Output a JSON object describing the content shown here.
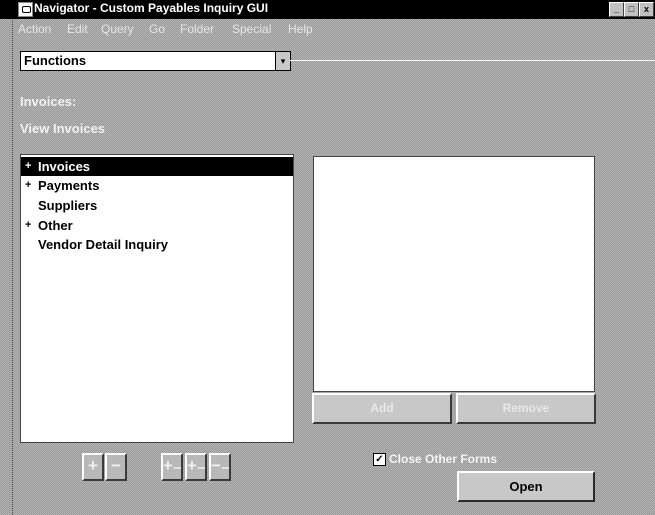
{
  "window": {
    "title": "Navigator - Custom Payables Inquiry GUI",
    "minimize_glyph": "_",
    "maximize_glyph": "□",
    "close_glyph": "x"
  },
  "menu": [
    {
      "label": "Action",
      "enabled": false
    },
    {
      "label": "Edit",
      "enabled": false
    },
    {
      "label": "Query",
      "enabled": false
    },
    {
      "label": "Go",
      "enabled": false
    },
    {
      "label": "Folder",
      "enabled": false
    },
    {
      "label": "Special",
      "enabled": false
    },
    {
      "label": "Help",
      "enabled": false
    }
  ],
  "functions_combo": {
    "value": "Functions",
    "arrow": "▾"
  },
  "labels": {
    "section": "Invoices:",
    "subsection": "View Invoices"
  },
  "tree": {
    "items": [
      {
        "marker": "+",
        "label": "Invoices",
        "selected": true
      },
      {
        "marker": "+",
        "label": "Payments",
        "selected": false
      },
      {
        "marker": "",
        "label": "Suppliers",
        "selected": false
      },
      {
        "marker": "+",
        "label": "Other",
        "selected": false
      },
      {
        "marker": "",
        "label": "Vendor Detail Inquiry",
        "selected": false
      }
    ]
  },
  "buttons": {
    "add": "Add",
    "remove": "Remove",
    "open": "Open"
  },
  "tree_controls": {
    "expand": "+",
    "collapse": "−",
    "expand_branch": "+₋",
    "expand_all": "+₋",
    "collapse_all": "−₋"
  },
  "close_other_forms": {
    "label": "Close Other Forms",
    "checked": true,
    "check_glyph": "✓"
  }
}
